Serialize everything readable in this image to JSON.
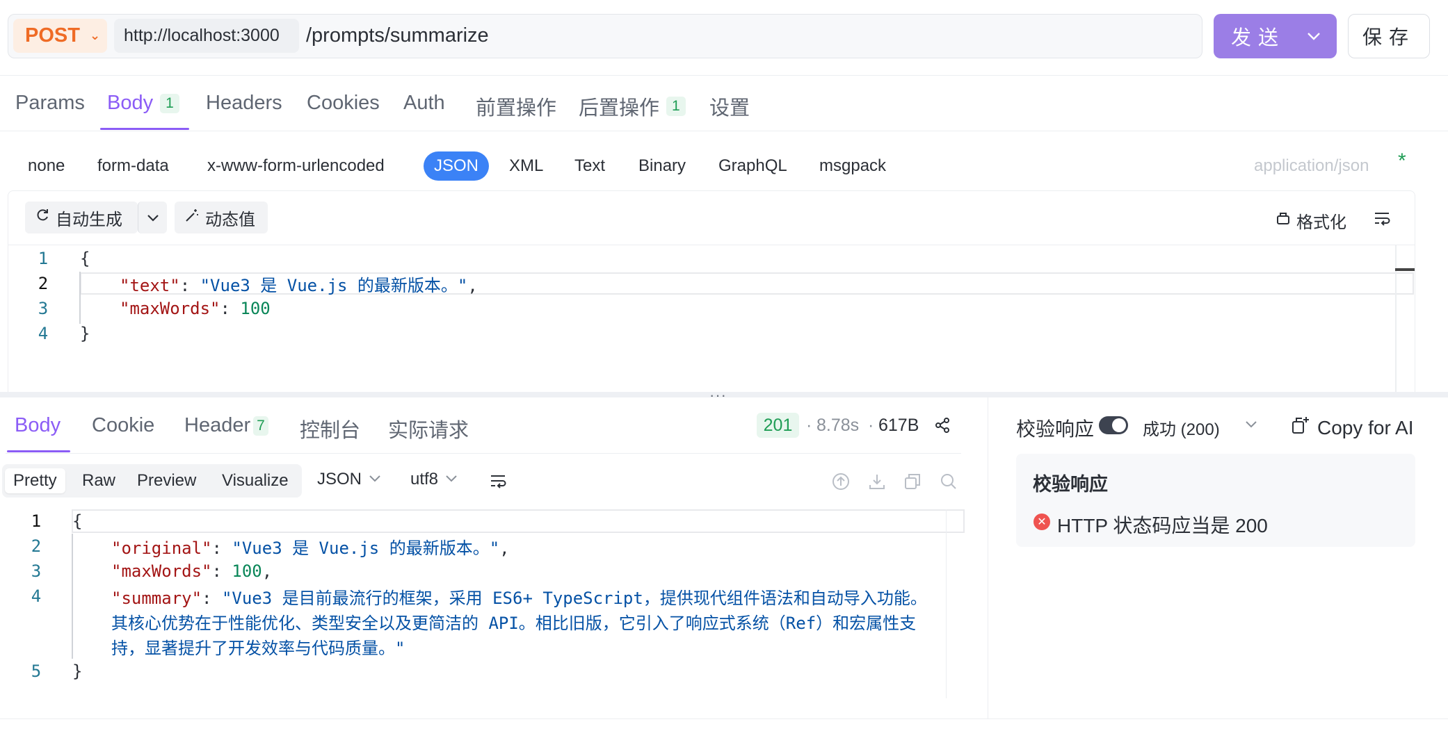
{
  "request": {
    "method": "POST",
    "host": "http://localhost:3000",
    "path": "/prompts/summarize",
    "send_label": "发送",
    "save_label": "保存"
  },
  "request_tabs": [
    {
      "label": "Params"
    },
    {
      "label": "Body",
      "badge": "1",
      "active": true
    },
    {
      "label": "Headers"
    },
    {
      "label": "Cookies"
    },
    {
      "label": "Auth"
    },
    {
      "label": "前置操作"
    },
    {
      "label": "后置操作",
      "badge": "1"
    },
    {
      "label": "设置"
    }
  ],
  "body_types": [
    "none",
    "form-data",
    "x-www-form-urlencoded",
    "JSON",
    "XML",
    "Text",
    "Binary",
    "GraphQL",
    "msgpack"
  ],
  "body_type_active": "JSON",
  "content_type": "application/json",
  "required_mark": "*",
  "editor_toolbar": {
    "auto_generate": "自动生成",
    "dynamic_value": "动态值",
    "format": "格式化"
  },
  "request_body": {
    "line_numbers": [
      "1",
      "2",
      "3",
      "4"
    ],
    "brace_open": "{",
    "brace_close": "}",
    "text_key": "\"text\"",
    "text_value": "\"Vue3 是 Vue.js 的最新版本。\"",
    "maxwords_key": "\"maxWords\"",
    "maxwords_value": "100"
  },
  "response_tabs": [
    {
      "label": "Body",
      "active": true
    },
    {
      "label": "Cookie"
    },
    {
      "label": "Header",
      "badge": "7"
    },
    {
      "label": "控制台"
    },
    {
      "label": "实际请求"
    }
  ],
  "response_meta": {
    "status": "201",
    "time": "8.78s",
    "size": "617B"
  },
  "view_modes": [
    "Pretty",
    "Raw",
    "Preview",
    "Visualize"
  ],
  "view_mode_active": "Pretty",
  "format_select": "JSON",
  "encoding_select": "utf8",
  "response_body": {
    "line_numbers": [
      "1",
      "2",
      "3",
      "4",
      "5"
    ],
    "brace_open": "{",
    "brace_close": "}",
    "original_key": "\"original\"",
    "original_value": "\"Vue3 是 Vue.js 的最新版本。\"",
    "maxwords_key": "\"maxWords\"",
    "maxwords_value": "100",
    "summary_key": "\"summary\"",
    "summary_line1": "\"Vue3 是目前最流行的框架，采用 ES6+ TypeScript，提供现代组件语法和自动导入功能。",
    "summary_line2": "其核心优势在于性能优化、类型安全以及更简洁的 API。相比旧版，它引入了响应式系统（Ref）和宏属性支",
    "summary_line3": "持，显著提升了开发效率与代码质量。\""
  },
  "validation": {
    "toggle_label": "校验响应",
    "toggle_on": true,
    "result_select": "成功 (200)",
    "copy_ai": "Copy for AI",
    "card_title": "校验响应",
    "assertion": "HTTP 状态码应当是 200"
  },
  "colors": {
    "accent": "#8b5cf6",
    "send_button": "#9b7ee6",
    "method": "#ef6b25",
    "success": "#1f9d55",
    "json_key": "#a31515",
    "json_string": "#0451a5",
    "json_number": "#098658"
  }
}
